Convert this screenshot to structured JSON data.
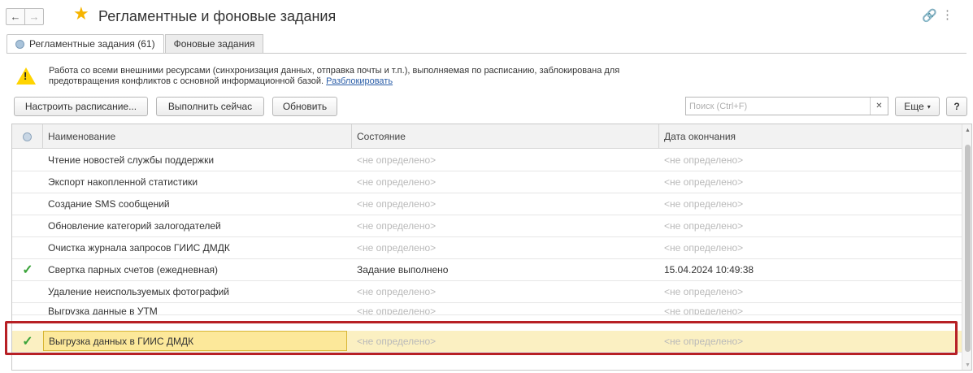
{
  "window": {
    "title": "Регламентные и фоновые задания"
  },
  "tabs": [
    {
      "label": "Регламентные задания (61)",
      "active": true
    },
    {
      "label": "Фоновые задания",
      "active": false
    }
  ],
  "warning": {
    "text": "Работа со всеми внешними ресурсами (синхронизация данных, отправка почты и т.п.), выполняемая по расписанию, заблокирована для предотвращения конфликтов с основной информационной базой.",
    "link": "Разблокировать"
  },
  "toolbar": {
    "schedule_label": "Настроить расписание...",
    "run_now_label": "Выполнить сейчас",
    "refresh_label": "Обновить",
    "more_label": "Еще",
    "help_label": "?"
  },
  "search": {
    "placeholder": "Поиск (Ctrl+F)",
    "value": ""
  },
  "table": {
    "columns": [
      "Наименование",
      "Состояние",
      "Дата окончания"
    ],
    "rows": [
      {
        "done": false,
        "name": "Чтение новостей службы поддержки",
        "state": "<не определено>",
        "end": "<не определено>"
      },
      {
        "done": false,
        "name": "Экспорт накопленной статистики",
        "state": "<не определено>",
        "end": "<не определено>"
      },
      {
        "done": false,
        "name": "Создание SMS сообщений",
        "state": "<не определено>",
        "end": "<не определено>"
      },
      {
        "done": false,
        "name": "Обновление категорий залогодателей",
        "state": "<не определено>",
        "end": "<не определено>"
      },
      {
        "done": false,
        "name": "Очистка журнала запросов ГИИС ДМДК",
        "state": "<не определено>",
        "end": "<не определено>"
      },
      {
        "done": true,
        "name": "Свертка парных счетов (ежедневная)",
        "state": "Задание выполнено",
        "end": "15.04.2024 10:49:38"
      },
      {
        "done": false,
        "name": "Удаление неиспользуемых фотографий",
        "state": "<не определено>",
        "end": "<не определено>"
      },
      {
        "done": false,
        "name": "Выгрузка данные в УТМ",
        "state": "<не определено>",
        "end": "<не определено>"
      },
      {
        "done": true,
        "name": "Выгрузка данных в ГИИС ДМДК",
        "state": "<не определено>",
        "end": "<не определено>",
        "selected": true
      }
    ]
  },
  "colors": {
    "highlight": "#b72025",
    "selected_row": "#fbf0c2",
    "check": "#3ba43a",
    "star": "#f6b400"
  }
}
